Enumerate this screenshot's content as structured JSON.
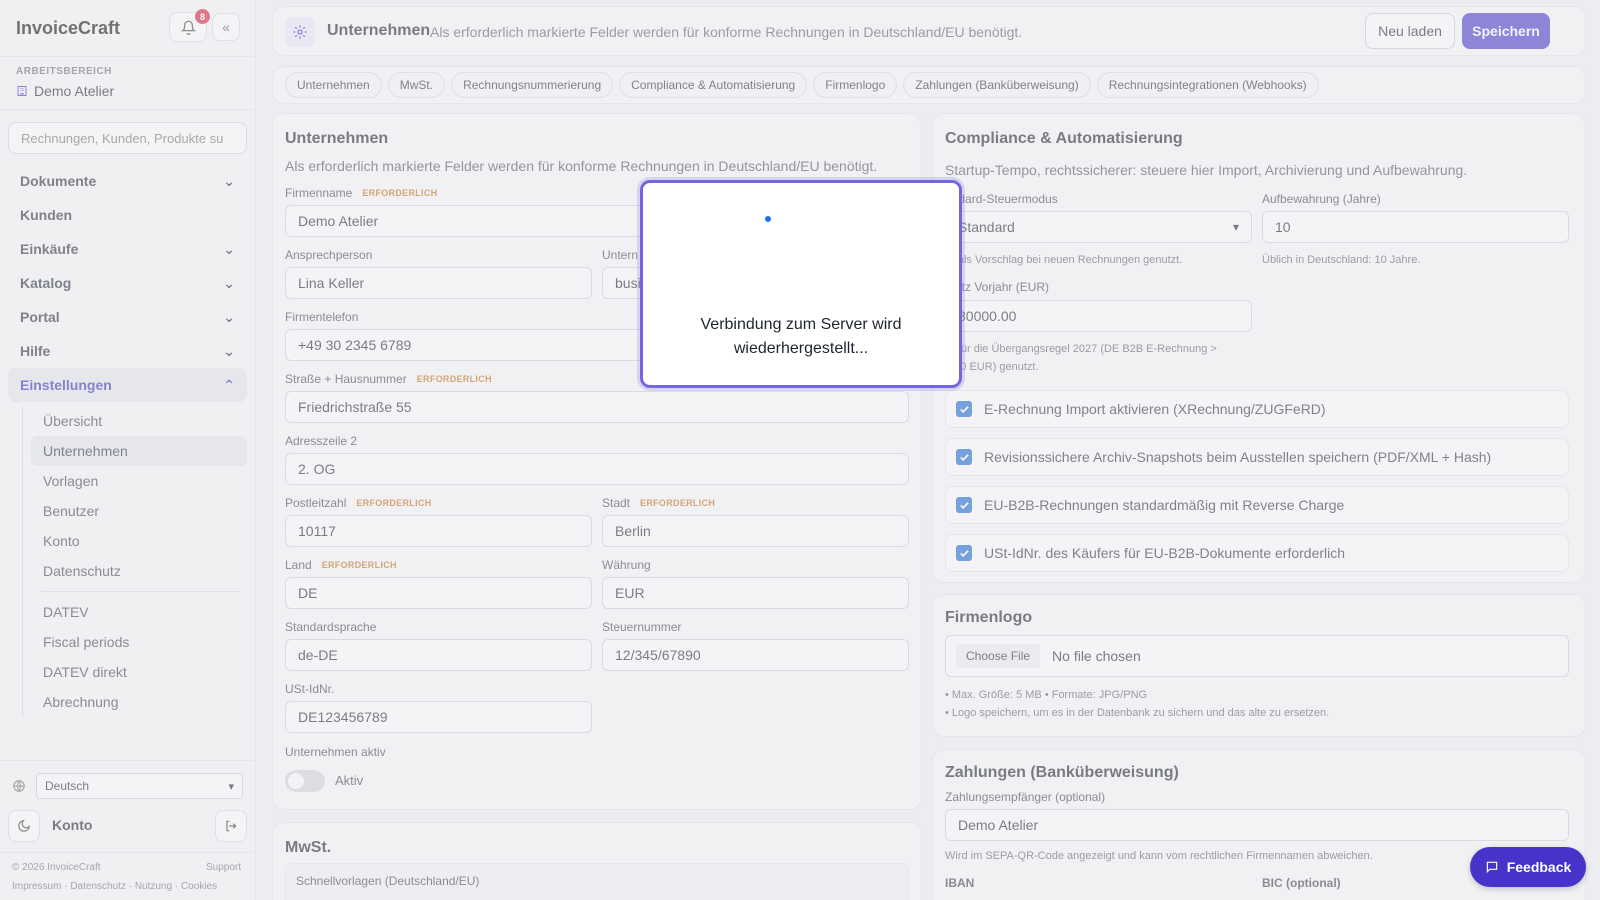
{
  "sidebar": {
    "brand": "InvoiceCraft",
    "notification_count": "8",
    "workspace_label": "ARBEITSBEREICH",
    "workspace_name": "Demo Atelier",
    "search_placeholder": "Rechnungen, Kunden, Produkte su",
    "nav": [
      {
        "label": "Dokumente",
        "chevron": "down"
      },
      {
        "label": "Kunden"
      },
      {
        "label": "Einkäufe",
        "chevron": "down"
      },
      {
        "label": "Katalog",
        "chevron": "down"
      },
      {
        "label": "Portal",
        "chevron": "down"
      },
      {
        "label": "Hilfe",
        "chevron": "down"
      },
      {
        "label": "Einstellungen",
        "chevron": "up"
      }
    ],
    "settings_items": [
      "Übersicht",
      "Unternehmen",
      "Vorlagen",
      "Benutzer",
      "Konto",
      "Datenschutz"
    ],
    "settings_items_2": [
      "DATEV",
      "Fiscal periods",
      "DATEV direkt",
      "Abrechnung"
    ],
    "language": "Deutsch",
    "account": "Konto",
    "footer_copyright": "© 2026 InvoiceCraft",
    "footer_support": "Support",
    "footer_links": "Impressum · Datenschutz · Nutzung · Cookies"
  },
  "header": {
    "title": "Unternehmen",
    "hint": "Als erforderlich markierte Felder werden für konforme Rechnungen in Deutschland/EU benötigt.",
    "reload_label": "Neu laden",
    "save_label": "Speichern"
  },
  "tabs": [
    "Unternehmen",
    "MwSt.",
    "Rechnungsnummerierung",
    "Compliance & Automatisierung",
    "Firmenlogo",
    "Zahlungen (Banküberweisung)",
    "Rechnungsintegrationen (Webhooks)"
  ],
  "company": {
    "title": "Unternehmen",
    "desc": "Als erforderlich markierte Felder werden für konforme Rechnungen in Deutschland/EU benötigt.",
    "required": "ERFORDERLICH",
    "firmenname_label": "Firmenname",
    "firmenname": "Demo Atelier",
    "ansprechperson_label": "Ansprechperson",
    "ansprechperson": "Lina Keller",
    "unternehmen_email_label": "Untern",
    "unternehmen_email": "busi",
    "telefon_label": "Firmentelefon",
    "telefon": "+49 30 2345 6789",
    "strasse_label": "Straße + Hausnummer",
    "strasse": "Friedrichstraße 55",
    "adresse2_label": "Adresszeile 2",
    "adresse2": "2. OG",
    "plz_label": "Postleitzahl",
    "plz": "10117",
    "stadt_label": "Stadt",
    "stadt": "Berlin",
    "land_label": "Land",
    "land": "DE",
    "waehrung_label": "Währung",
    "waehrung": "EUR",
    "sprache_label": "Standardsprache",
    "sprache": "de-DE",
    "steuernummer_label": "Steuernummer",
    "steuernummer": "12/345/67890",
    "ustid_label": "USt-IdNr.",
    "ustid": "DE123456789",
    "aktiv_label": "Unternehmen aktiv",
    "aktiv_text": "Aktiv"
  },
  "vat": {
    "title": "MwSt.",
    "quick_label": "Schnellvorlagen (Deutschland/EU)"
  },
  "compliance": {
    "title": "Compliance & Automatisierung",
    "desc": "Startup-Tempo, rechtssicherer: steuere hier Import, Archivierung und Aufbewahrung.",
    "tax_mode_label": "andard-Steuermodus",
    "tax_mode": "Standard",
    "tax_mode_hint": "rd als Vorschlag bei neuen Rechnungen genutzt.",
    "retention_label": "Aufbewahrung (Jahre)",
    "retention": "10",
    "retention_hint": "Üblich in Deutschland: 10 Jahre.",
    "revenue_label": "rsatz Vorjahr (EUR)",
    "revenue": "80000.00",
    "revenue_hint_1": "rd für die Übergangsregel 2027 (DE B2B E-Rechnung >",
    "revenue_hint_2": ".000 EUR) genutzt.",
    "checks": [
      "E-Rechnung Import aktivieren (XRechnung/ZUGFeRD)",
      "Revisionssichere Archiv-Snapshots beim Ausstellen speichern (PDF/XML + Hash)",
      "EU-B2B-Rechnungen standardmäßig mit Reverse Charge",
      "USt-IdNr. des Käufers für EU-B2B-Dokumente erforderlich"
    ]
  },
  "logo": {
    "title": "Firmenlogo",
    "choose_file": "Choose File",
    "no_file": "No file chosen",
    "hint_1": "• Max. Größe: 5 MB • Formate: JPG/PNG",
    "hint_2": "• Logo speichern, um es in der Datenbank zu sichern und das alte zu ersetzen."
  },
  "payments": {
    "title": "Zahlungen (Banküberweisung)",
    "recipient_label": "Zahlungsempfänger (optional)",
    "recipient": "Demo Atelier",
    "recipient_hint": "Wird im SEPA-QR-Code angezeigt und kann vom rechtlichen Firmennamen abweichen.",
    "iban_label": "IBAN",
    "bic_label": "BIC (optional)"
  },
  "modal": {
    "message": "Verbindung zum Server wird wiederhergestellt..."
  },
  "feedback_label": "Feedback",
  "colors": {
    "accent": "#4633c9",
    "required": "#c4701a",
    "checkbox": "#1a66d4",
    "badge": "#d11f3c"
  }
}
